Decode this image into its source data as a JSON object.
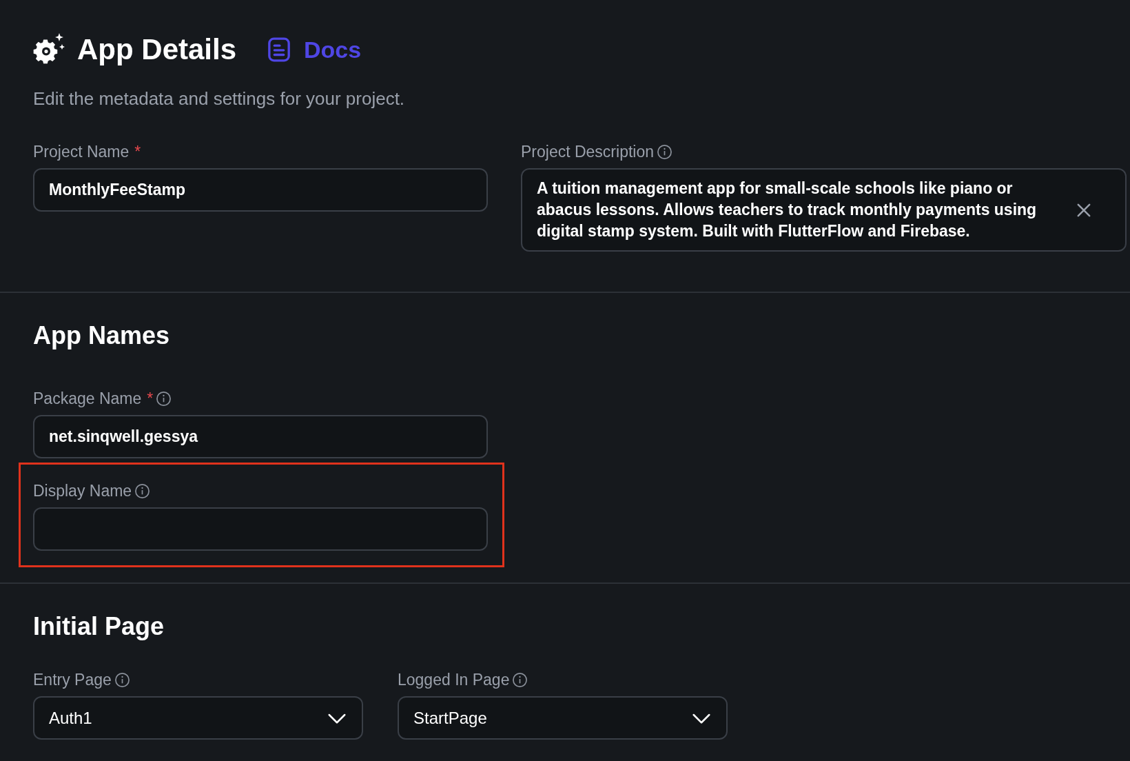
{
  "header": {
    "title": "App Details",
    "docs_link": "Docs",
    "subtitle": "Edit the metadata and settings for your project."
  },
  "project_fields": [
    {
      "kind": "text",
      "label": "Project Name",
      "required_mark": "*",
      "info": false,
      "value": "MonthlyFeeStamp",
      "highlighted": false
    },
    {
      "kind": "textarea",
      "label": "Project Description",
      "info": true,
      "value": "A tuition management app for small-scale schools like piano or abacus lessons. Allows teachers to track monthly payments using digital stamp system. Built with FlutterFlow and Firebase.",
      "clearable": true,
      "highlighted": false
    }
  ],
  "sections": [
    {
      "title": "App Names",
      "kind": "stack",
      "fields": [
        {
          "kind": "text",
          "label": "Package Name",
          "required_mark": "*",
          "info": true,
          "value": "net.sinqwell.gessya",
          "highlighted": false
        },
        {
          "kind": "text",
          "label": "Display Name",
          "info": true,
          "highlighted": true
        }
      ]
    },
    {
      "title": "Initial Page",
      "kind": "row",
      "fields": [
        {
          "kind": "dropdown",
          "label": "Entry Page",
          "info": true,
          "value": "Auth1",
          "highlighted": false
        },
        {
          "kind": "dropdown",
          "label": "Logged In Page",
          "info": true,
          "value": "StartPage",
          "highlighted": false
        }
      ]
    }
  ]
}
